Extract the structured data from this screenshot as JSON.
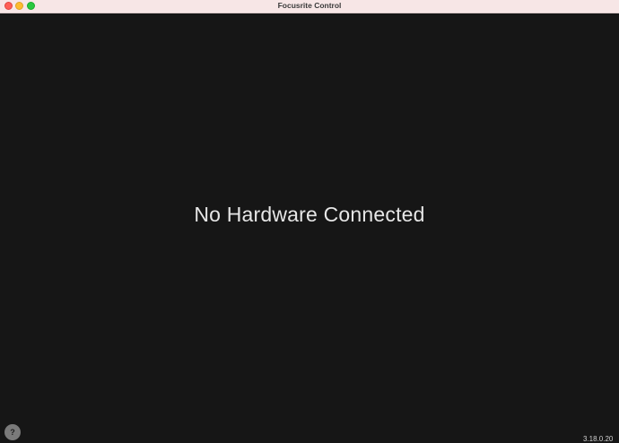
{
  "window": {
    "title": "Focusrite Control",
    "controls": {
      "close_icon": "close-icon",
      "minimize_icon": "minimize-icon",
      "maximize_icon": "maximize-icon"
    }
  },
  "main": {
    "message": "No Hardware Connected"
  },
  "footer": {
    "help_label": "?",
    "version": "3.18.0.20"
  },
  "colors": {
    "background": "#161616",
    "titlebar": "#f7e6e6",
    "text": "#e6e6e6",
    "help_button": "#7a7a7a"
  }
}
